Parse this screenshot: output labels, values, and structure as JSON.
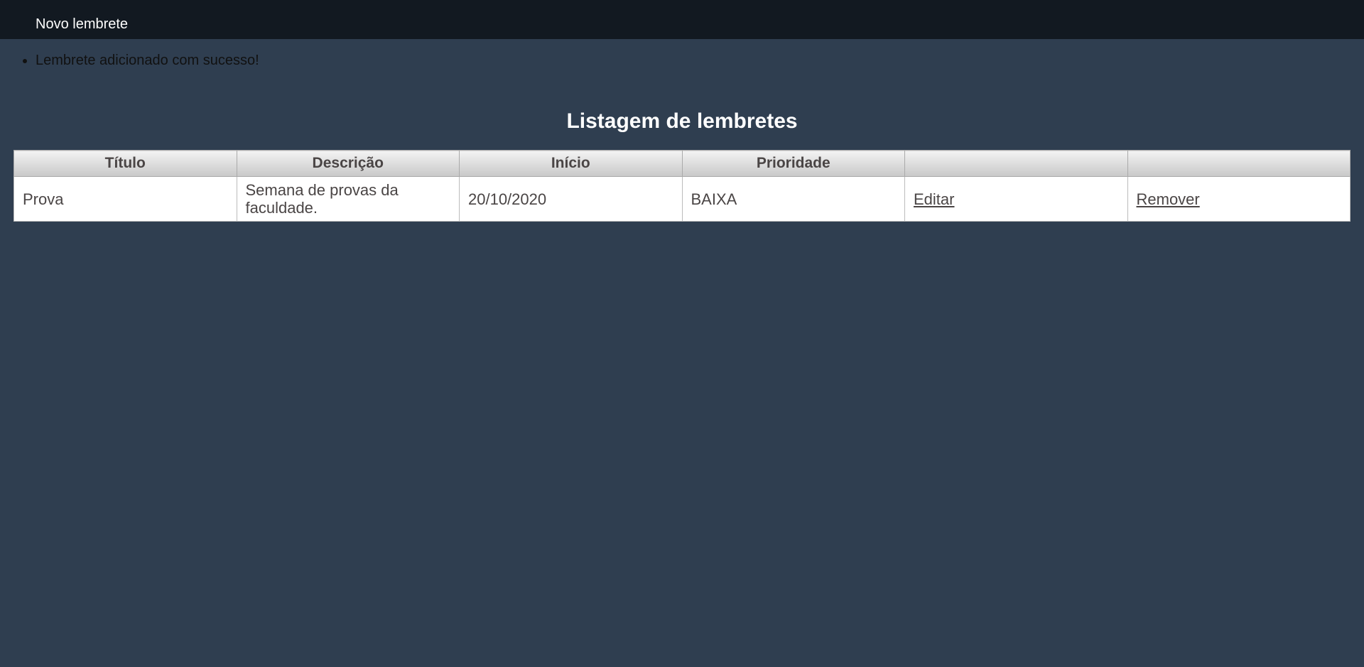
{
  "nav": {
    "new_reminder": "Novo lembrete"
  },
  "messages": [
    "Lembrete adicionado com sucesso!"
  ],
  "page_title": "Listagem de lembretes",
  "table": {
    "headers": [
      "Título",
      "Descrição",
      "Início",
      "Prioridade",
      "",
      ""
    ],
    "rows": [
      {
        "titulo": "Prova",
        "descricao": "Semana de provas da faculdade.",
        "inicio": "20/10/2020",
        "prioridade": "BAIXA",
        "edit_label": "Editar",
        "remove_label": "Remover"
      }
    ]
  }
}
